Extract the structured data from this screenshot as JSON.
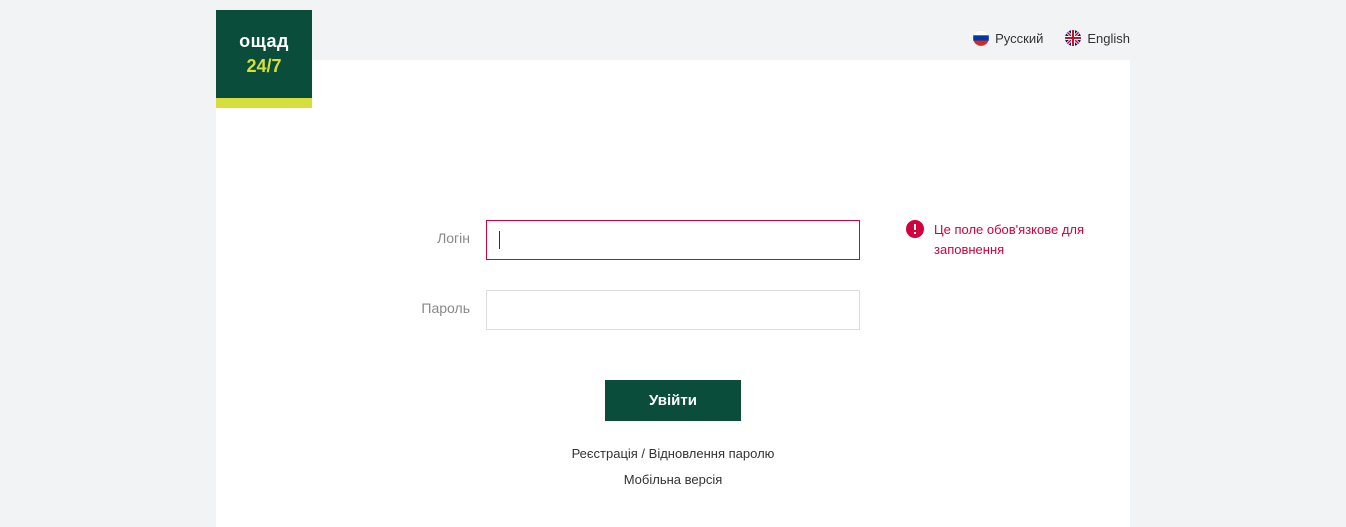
{
  "logo": {
    "brand": "ощад",
    "sub": "24/7"
  },
  "languages": {
    "ru": "Русский",
    "en": "English"
  },
  "form": {
    "login_label": "Логін",
    "login_value": "",
    "password_label": "Пароль",
    "password_value": "",
    "submit_label": "Увійти",
    "error_message": "Це поле обов'язкове для заповнення"
  },
  "links": {
    "register_recover": "Реєстрація / Відновлення паролю",
    "mobile_version": "Мобільна версія"
  }
}
